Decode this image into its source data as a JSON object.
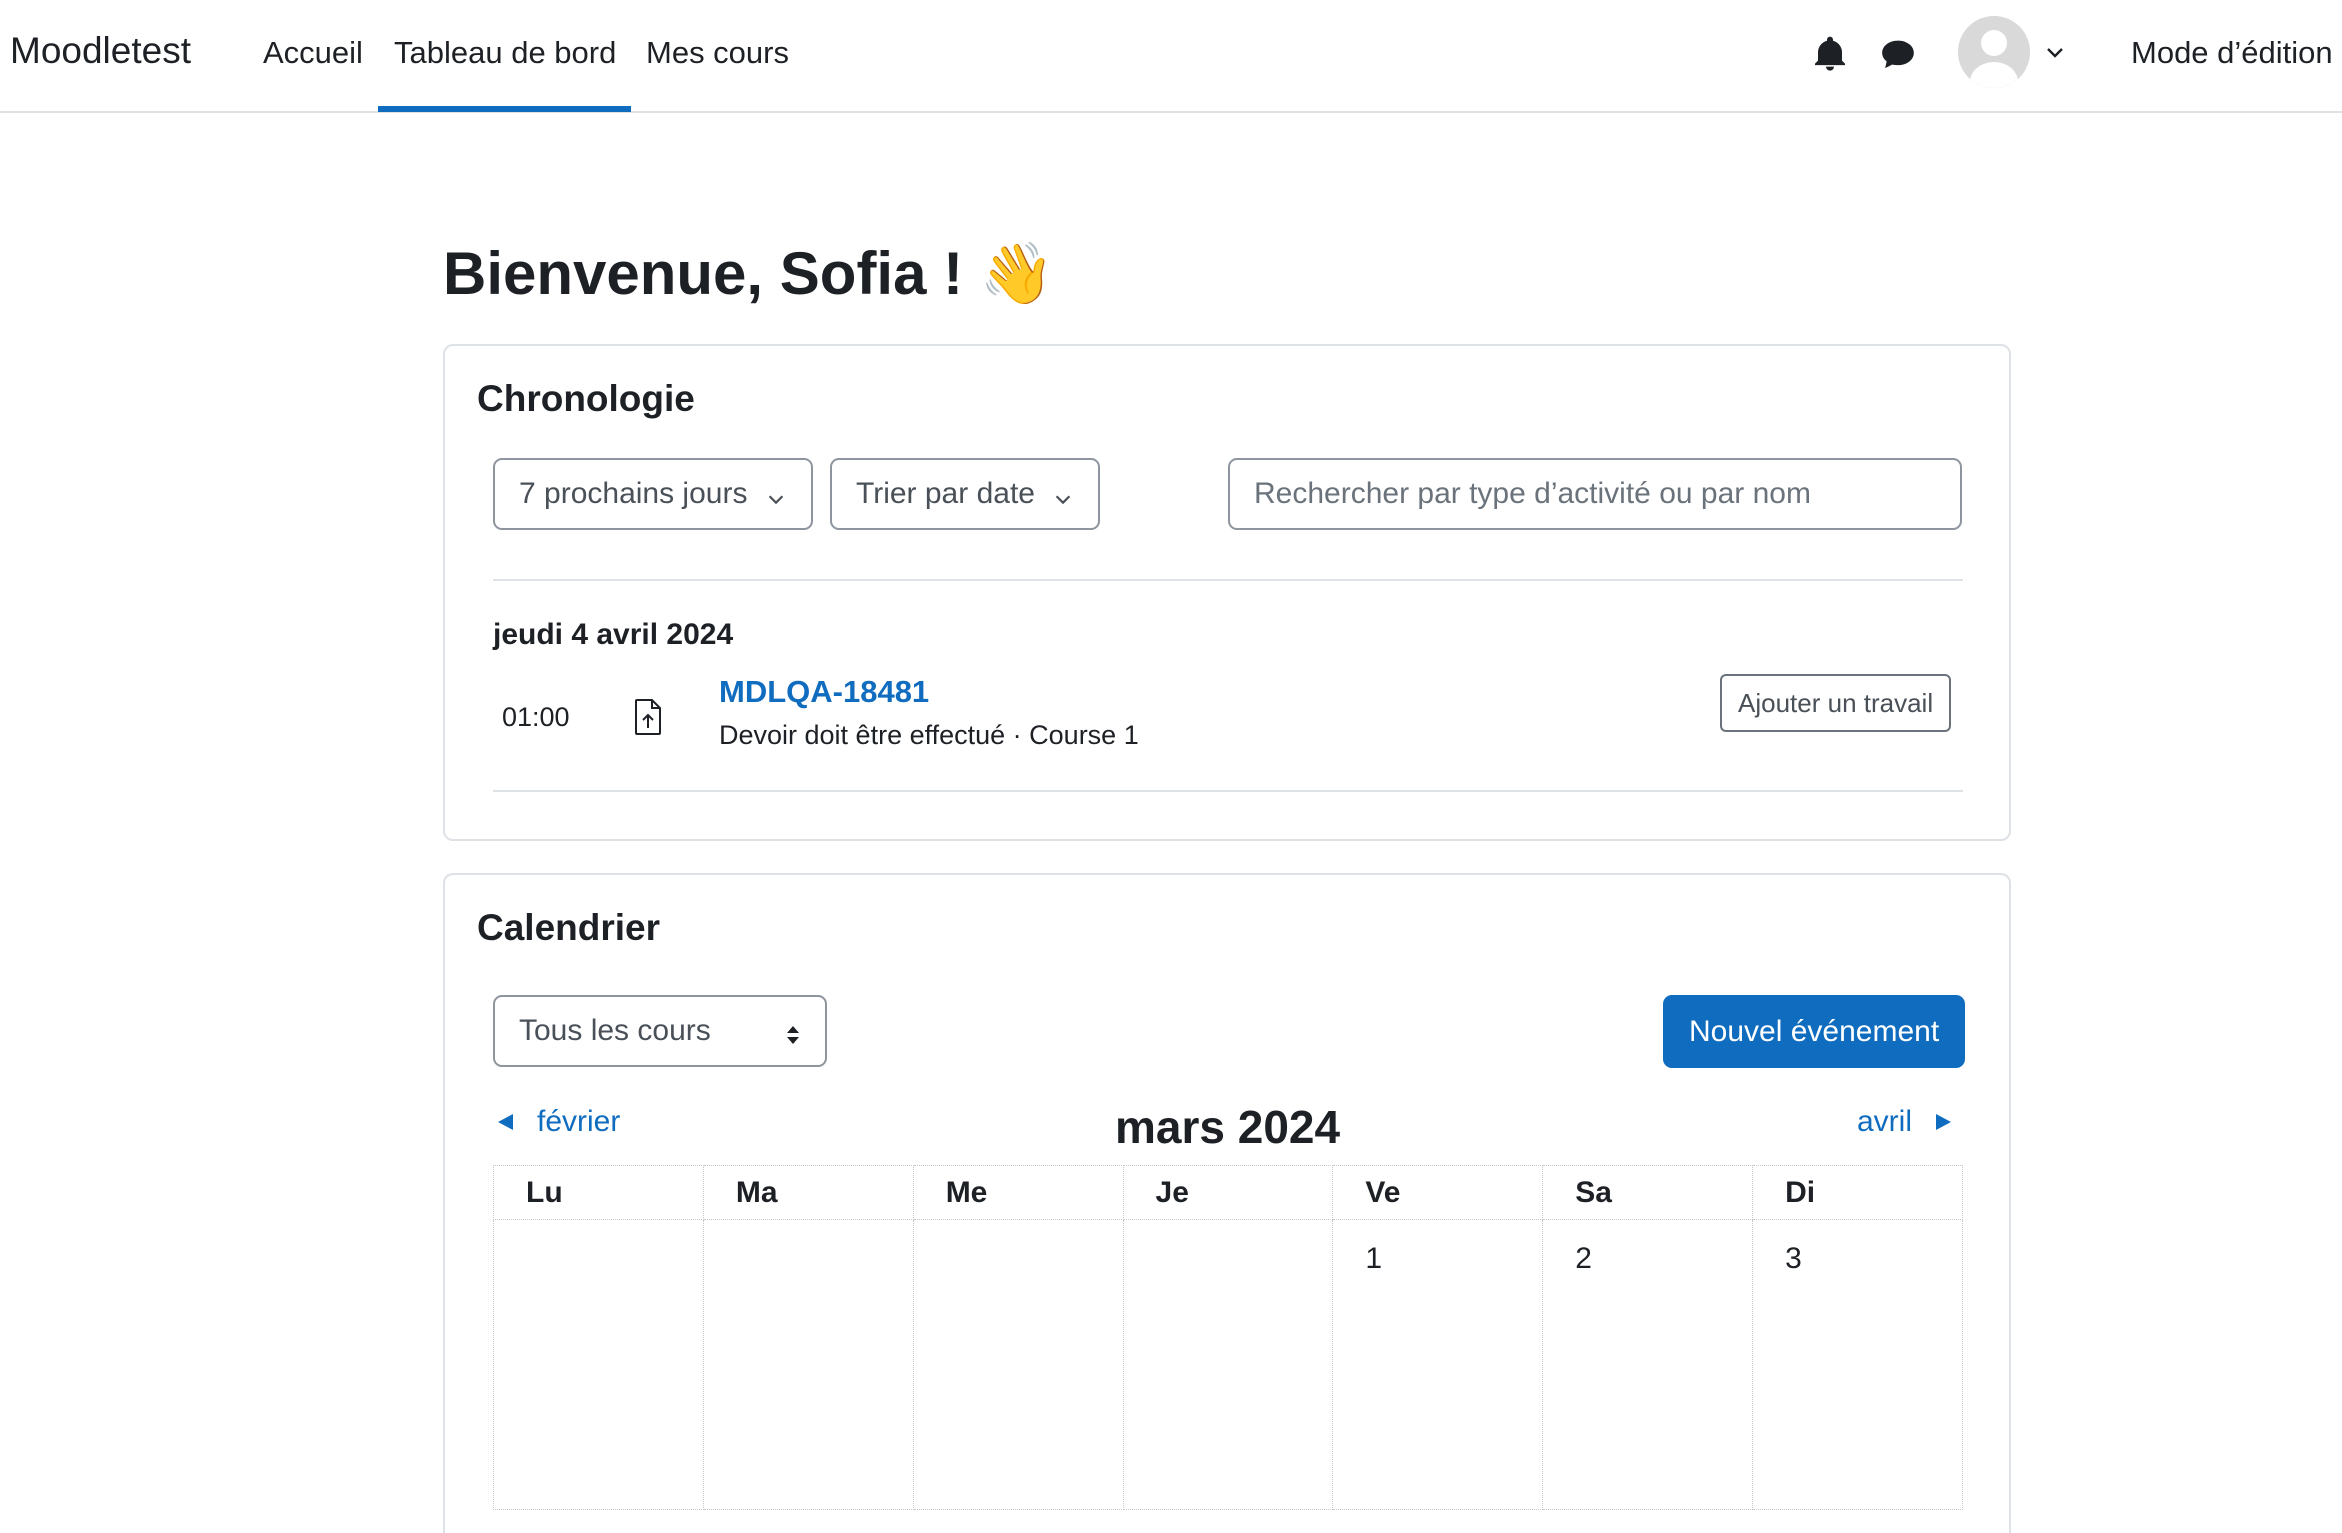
{
  "navbar": {
    "brand": "Moodletest",
    "links": {
      "home": "Accueil",
      "dashboard": "Tableau de bord",
      "my_courses": "Mes cours"
    },
    "active_link": "Tableau de bord",
    "icons": [
      "bell-icon",
      "chat-bubble-icon",
      "user-avatar",
      "chevron-down-icon"
    ],
    "edit_mode_label": "Mode d’édition"
  },
  "page": {
    "welcome": "Bienvenue, Sofia !",
    "welcome_emoji": "👋"
  },
  "timeline": {
    "title": "Chronologie",
    "filter_label": "7 prochains jours",
    "sort_label": "Trier par date",
    "search_placeholder": "Rechercher par type d’activité ou par nom",
    "date_heading": "jeudi 4 avril 2024",
    "event": {
      "time": "01:00",
      "icon": "assignment-upload-icon",
      "name": "MDLQA-18481",
      "subtitle": "Devoir doit être effectué · Course 1",
      "action_label": "Ajouter un travail"
    }
  },
  "calendar": {
    "title": "Calendrier",
    "course_filter": "Tous les cours",
    "new_event_label": "Nouvel événement",
    "prev_month": "février",
    "next_month": "avril",
    "current_month": "mars 2024",
    "weekdays": [
      "Lu",
      "Ma",
      "Me",
      "Je",
      "Ve",
      "Sa",
      "Di"
    ],
    "first_week": [
      "",
      "",
      "",
      "",
      "1",
      "2",
      "3"
    ]
  },
  "colors": {
    "accent": "#0f6cbf",
    "border": "#dee2e6",
    "text": "#1d2125",
    "muted": "#495057"
  }
}
